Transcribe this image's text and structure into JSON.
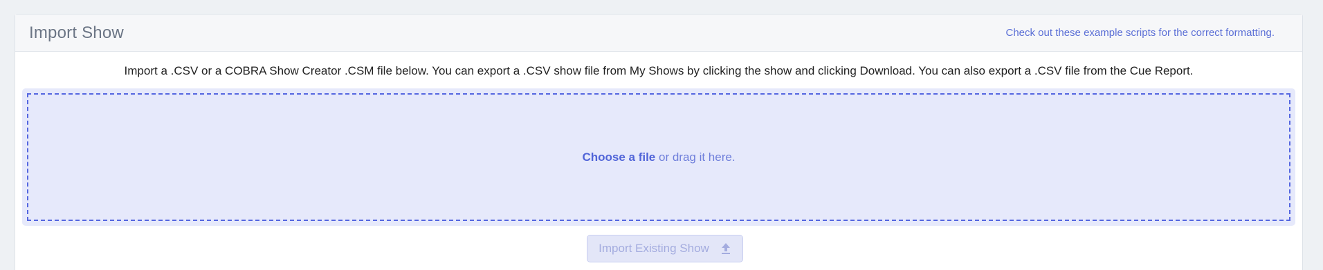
{
  "header": {
    "title": "Import Show",
    "help_link": "Check out these example scripts for the correct formatting."
  },
  "body": {
    "intro": "Import a .CSV or a COBRA Show Creator .CSM file below. You can export a .CSV show file from My Shows by clicking the show and clicking Download. You can also export a .CSV file from the Cue Report."
  },
  "dropzone": {
    "choose_file": "Choose a file",
    "drag_text": " or drag it here."
  },
  "import_button": {
    "label": "Import Existing Show",
    "icon": "upload-icon",
    "disabled": true
  },
  "colors": {
    "accent": "#5064d8",
    "dropzone_bg": "#e6e9fb",
    "button_disabled_text": "#a4acdf"
  }
}
